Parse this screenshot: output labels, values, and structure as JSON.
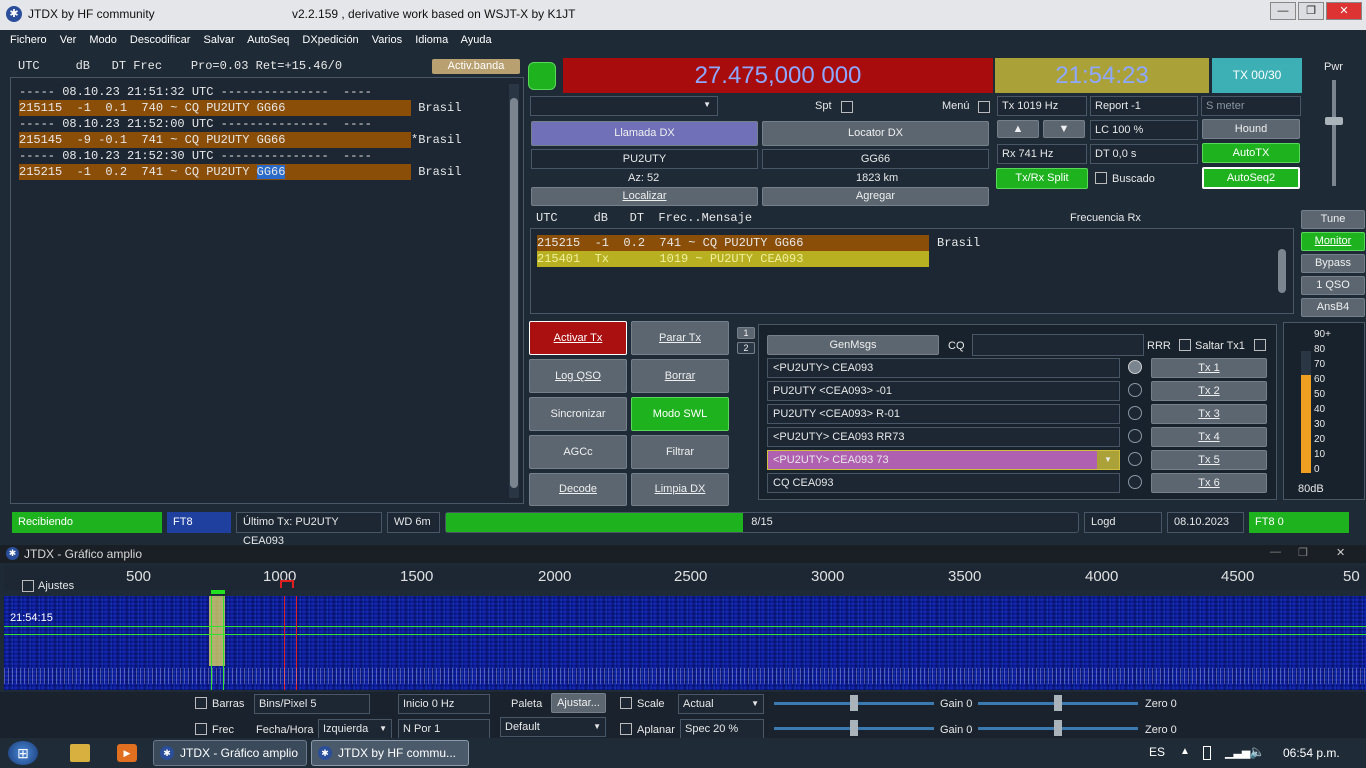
{
  "window": {
    "title": "JTDX  by HF community",
    "version": "v2.2.159 , derivative work based on WSJT-X by K1JT"
  },
  "menu": [
    "Fichero",
    "Ver",
    "Modo",
    "Descodificar",
    "Salvar",
    "AutoSeq",
    "DXpedición",
    "Varios",
    "Idioma",
    "Ayuda"
  ],
  "band_header": {
    "text": "UTC     dB   DT Frec    Pro=0.03 Ret=+15.46/0",
    "activ": "Activ.banda"
  },
  "band_rows": [
    {
      "text": "----- 08.10.23 21:51:32 UTC ---------------  ----",
      "country": "",
      "type": "sep"
    },
    {
      "text": "215115  -1  0.1  740 ~ CQ PU2UTY GG66",
      "country": " Brasil",
      "type": "cq"
    },
    {
      "text": "----- 08.10.23 21:52:00 UTC ---------------  ----",
      "country": "",
      "type": "sep"
    },
    {
      "text": "215145  -9 -0.1  741 ~ CQ PU2UTY GG66",
      "country": "*Brasil",
      "type": "cq"
    },
    {
      "text": "----- 08.10.23 21:52:30 UTC ---------------  ----",
      "country": "",
      "type": "sep"
    },
    {
      "text": "215215  -1  0.2  741 ~ CQ PU2UTY ",
      "highlight": "GG66",
      "country": " Brasil",
      "type": "cq"
    }
  ],
  "freq": "27.475,000 000",
  "clock": "21:54:23",
  "tx_period": "TX 00/30",
  "pwr": "Pwr",
  "spt": "Spt",
  "menu_lbl": "Menú",
  "tx_hz": "Tx  1019  Hz",
  "rx_hz": "Rx  741  Hz",
  "report": "Report -1",
  "lc": "LC  100 %",
  "dt": "DT 0,0 s",
  "smeter": "S meter",
  "hound": "Hound",
  "autotx": "AutoTX",
  "autoseq2": "AutoSeq2",
  "txrxsplit": "Tx/Rx Split",
  "buscado": "Buscado",
  "llamada_dx": "Llamada DX",
  "locator_dx": "Locator DX",
  "dx_call": "PU2UTY",
  "dx_grid": "GG66",
  "az": "Az: 52",
  "dist": "1823 km",
  "localizar": "Localizar",
  "agregar": "Agregar",
  "rx_header": "UTC     dB   DT  Frec..Mensaje",
  "frecuencia_rx": "Frecuencia Rx",
  "rx_rows": [
    {
      "text": "215215  -1  0.2  741 ~ CQ PU2UTY GG66",
      "country": "Brasil",
      "type": "cq"
    },
    {
      "text": "215401  Tx       1019 ~ PU2UTY CEA093",
      "country": "",
      "type": "tx"
    }
  ],
  "side_btns": [
    "Tune",
    "Monitor",
    "Bypass",
    "1 QSO",
    "AnsB4"
  ],
  "controls": [
    "Activar Tx",
    "Parar Tx",
    "Log QSO",
    "Borrar",
    "Sincronizar",
    "Modo SWL",
    "AGCc",
    "Filtrar",
    "Decode",
    "Limpia DX"
  ],
  "tabs": [
    "1",
    "2"
  ],
  "genmsgs": "GenMsgs",
  "cq_lbl": "CQ",
  "rrr": "RRR",
  "saltar": "Saltar Tx1",
  "messages": [
    "<PU2UTY> CEA093",
    "PU2UTY <CEA093> -01",
    "PU2UTY <CEA093> R-01",
    "<PU2UTY> CEA093 RR73",
    "<PU2UTY> CEA093 73",
    "CQ CEA093"
  ],
  "tx_buttons": [
    "Tx 1",
    "Tx 2",
    "Tx 3",
    "Tx 4",
    "Tx 5",
    "Tx 6"
  ],
  "meter": {
    "ticks": [
      "90+",
      "80",
      "70",
      "60",
      "50",
      "40",
      "30",
      "20",
      "10",
      "0"
    ],
    "db": "80dB",
    "level": 0.8
  },
  "status": {
    "state": "Recibiendo",
    "mode": "FT8",
    "last_tx": "Último Tx: PU2UTY CEA093",
    "wd": "WD 6m",
    "progress": "8/15",
    "progress_val": 0.47,
    "logd": "Logd",
    "date": "08.10.2023",
    "ft8": "FT8  0"
  },
  "waterfall": {
    "title": "JTDX - Gráfico amplio",
    "ajustes": "Ajustes",
    "scale": [
      "500",
      "1000",
      "1500",
      "2000",
      "2500",
      "3000",
      "3500",
      "4000",
      "4500",
      "50"
    ],
    "time": "21:54:15",
    "barras": "Barras",
    "frec": "Frec",
    "bins": "Bins/Pixel  5",
    "inicio": "Inicio 0 Hz",
    "fechahora": "Fecha/Hora",
    "izquierda": "Izquierda",
    "npor": "N Por  1",
    "paleta": "Paleta",
    "ajustar": "Ajustar...",
    "default": "Default",
    "scale_lbl": "Scale",
    "actual": "Actual",
    "aplanar": "Aplanar",
    "spec": "Spec 20 %",
    "gain1": "Gain 0",
    "zero1": "Zero 0",
    "gain2": "Gain 0",
    "zero2": "Zero 0"
  },
  "taskbar": {
    "item1": "JTDX - Gráfico amplio",
    "item2": "JTDX  by HF commu...",
    "lang": "ES",
    "time": "06:54 p.m."
  }
}
